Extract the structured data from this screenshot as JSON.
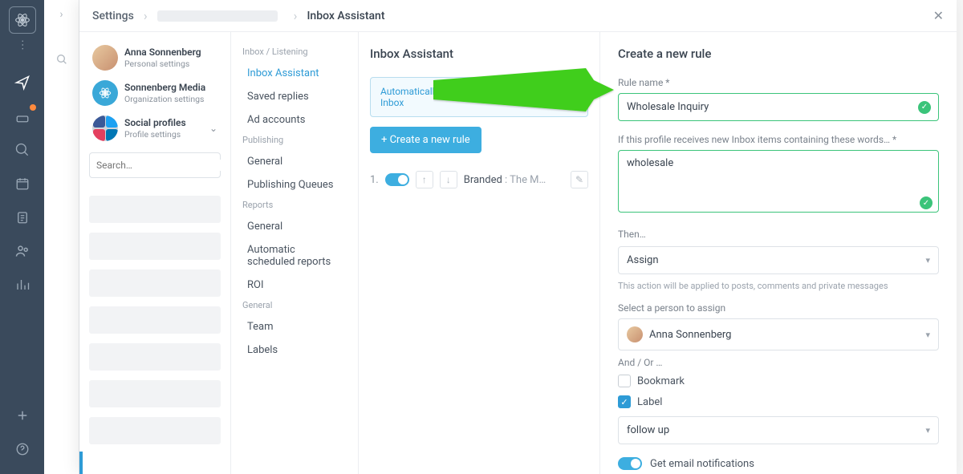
{
  "rail": {
    "logo_name": "app-logo"
  },
  "breadcrumbs": {
    "root": "Settings",
    "current": "Inbox Assistant"
  },
  "profiles": [
    {
      "name": "Anna Sonnenberg",
      "sub": "Personal settings",
      "avatar": "person"
    },
    {
      "name": "Sonnenberg Media",
      "sub": "Organization settings",
      "avatar": "org"
    },
    {
      "name": "Social profiles",
      "sub": "Profile settings",
      "avatar": "socials",
      "expandable": true
    }
  ],
  "search": {
    "placeholder": "Search…"
  },
  "nav": {
    "groups": [
      {
        "title": "Inbox / Listening",
        "items": [
          "Inbox Assistant",
          "Saved replies",
          "Ad accounts"
        ],
        "active": "Inbox Assistant"
      },
      {
        "title": "Publishing",
        "items": [
          "General",
          "Publishing Queues"
        ]
      },
      {
        "title": "Reports",
        "items": [
          "General",
          "Automatic scheduled reports",
          "ROI"
        ]
      },
      {
        "title": "General",
        "items": [
          "Team",
          "Labels"
        ]
      }
    ]
  },
  "panel": {
    "title": "Inbox Assistant",
    "banner": "Automatically clean up and organize your Inbox",
    "create_btn": "+ Create a new rule",
    "rule_index": "1.",
    "rule_name_prefix": "Branded",
    "rule_name_rest": ": The M…"
  },
  "form": {
    "title": "Create a new rule",
    "rule_name_label": "Rule name *",
    "rule_name_value": "Wholesale Inquiry",
    "keywords_label": "If this profile receives new Inbox items containing these words… *",
    "keywords_value": "wholesale",
    "then_label": "Then…",
    "action_value": "Assign",
    "action_help": "This action will be applied to posts, comments and private messages",
    "person_label": "Select a person to assign",
    "person_value": "Anna Sonnenberg",
    "andor_label": "And / Or …",
    "bookmark_label": "Bookmark",
    "label_label": "Label",
    "label_value": "follow up",
    "notify_label": "Get email notifications"
  }
}
